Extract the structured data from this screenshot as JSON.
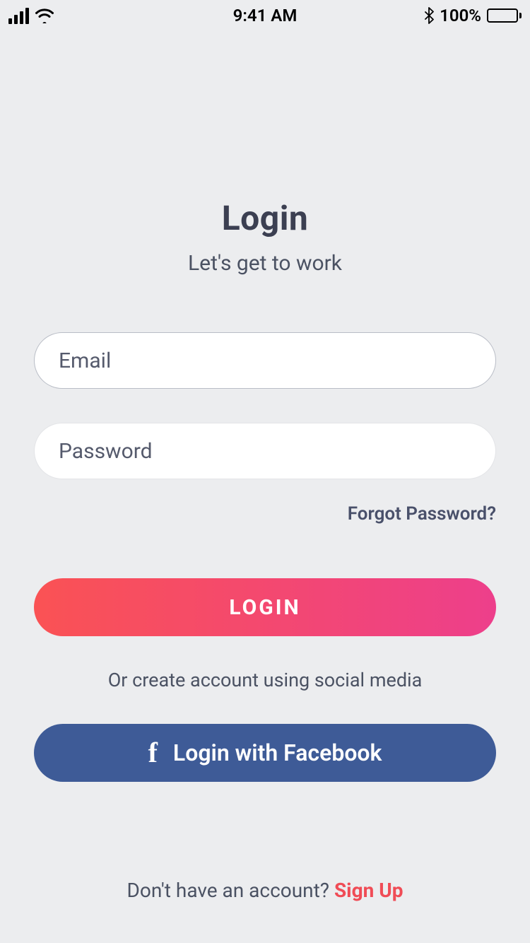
{
  "status_bar": {
    "time": "9:41 AM",
    "battery_percent": "100%"
  },
  "header": {
    "title": "Login",
    "subtitle": "Let's get to work"
  },
  "form": {
    "email_placeholder": "Email",
    "password_placeholder": "Password",
    "forgot_label": "Forgot Password?"
  },
  "actions": {
    "login_label": "LOGIN",
    "social_text": "Or create account using social media",
    "facebook_label": "Login with Facebook"
  },
  "footer": {
    "prompt": "Don't have an account? ",
    "signup_label": "Sign Up"
  }
}
